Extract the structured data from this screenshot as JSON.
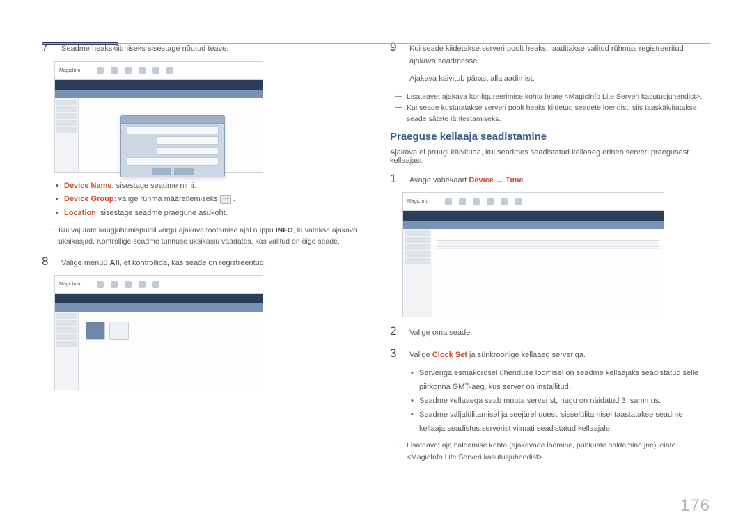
{
  "pageNumber": "176",
  "left": {
    "step7": {
      "num": "7",
      "text": "Seadme heakskiitmiseks sisestage nõutud teave."
    },
    "screenshot1": {
      "logo": "MagicInfo"
    },
    "bullets7": {
      "b1_label": "Device Name",
      "b1_text": ": sisestage seadme nimi.",
      "b2_label": "Device Group",
      "b2_text": ": valige rühma määratlemiseks ",
      "b3_label": "Location",
      "b3_text": ": sisestage seadme praegune asukoht."
    },
    "dash7": "Kui vajutate kaugjuhtimispuldil võrgu ajakava töötamise ajal nuppu INFO, kuvatakse ajakava üksikasjad. Kontrollige seadme tunnuse üksikasju vaadates, kas valitud on õige seade.",
    "dash7_bold": "INFO",
    "step8": {
      "num": "8",
      "text_a": "Valige menüü ",
      "text_bold": "All",
      "text_b": ", et kontrollida, kas seade on registreeritud."
    },
    "screenshot2": {
      "logo": "MagicInfo"
    }
  },
  "right": {
    "step9": {
      "num": "9",
      "line1": "Kui seade kiidetakse serveri poolt heaks, laaditakse valitud rühmas registreeritud ajakava seadmesse.",
      "line2": "Ajakava käivitub pärast allalaadimist."
    },
    "dash9": {
      "d1": "Lisateavet ajakava konfigureerimise kohta leiate <MagicInfo Lite Serveri kasutusjuhendist>.",
      "d2": "Kui seade kustutatakse serveri poolt heaks kiidetud seadete loendist, siis taaskäivitatakse seade sätete lähtestamiseks."
    },
    "section": {
      "heading": "Praeguse kellaaja seadistamine",
      "intro": "Ajakava ei pruugi käivituda, kui seadmes seadistatud kellaaeg erineb serveri praegusest kellaajast."
    },
    "step1": {
      "num": "1",
      "text_a": "Avage vahekaart ",
      "text_hl": "Device → Time",
      "text_b": "."
    },
    "screenshot3": {
      "logo": "MagicInfo"
    },
    "step2": {
      "num": "2",
      "text": "Valige oma seade."
    },
    "step3": {
      "num": "3",
      "text_a": "Valige ",
      "text_hl": "Clock Set",
      "text_b": " ja sünkroonige kellaaeg serveriga."
    },
    "bullets3": {
      "b1": "Serveriga esmakordsel ühenduse loomisel on seadme kellaajaks seadistatud selle piirkonna GMT-aeg, kus server on installitud.",
      "b2": "Seadme kellaaega saab muuta serverist, nagu on näidatud 3. sammus.",
      "b3": "Seadme väljalülitamisel ja seejärel uuesti sisselülitamisel taastatakse seadme kellaaja seadistus serverist viimati seadistatud kellaajale."
    },
    "dash3": "Lisateavet aja haldamise kohta (ajakavade loomine, puhkuste haldamine jne) leiate <MagicInfo Lite Serveri kasutusjuhendist>."
  },
  "btn": {
    "ellipsis": "⋯"
  }
}
